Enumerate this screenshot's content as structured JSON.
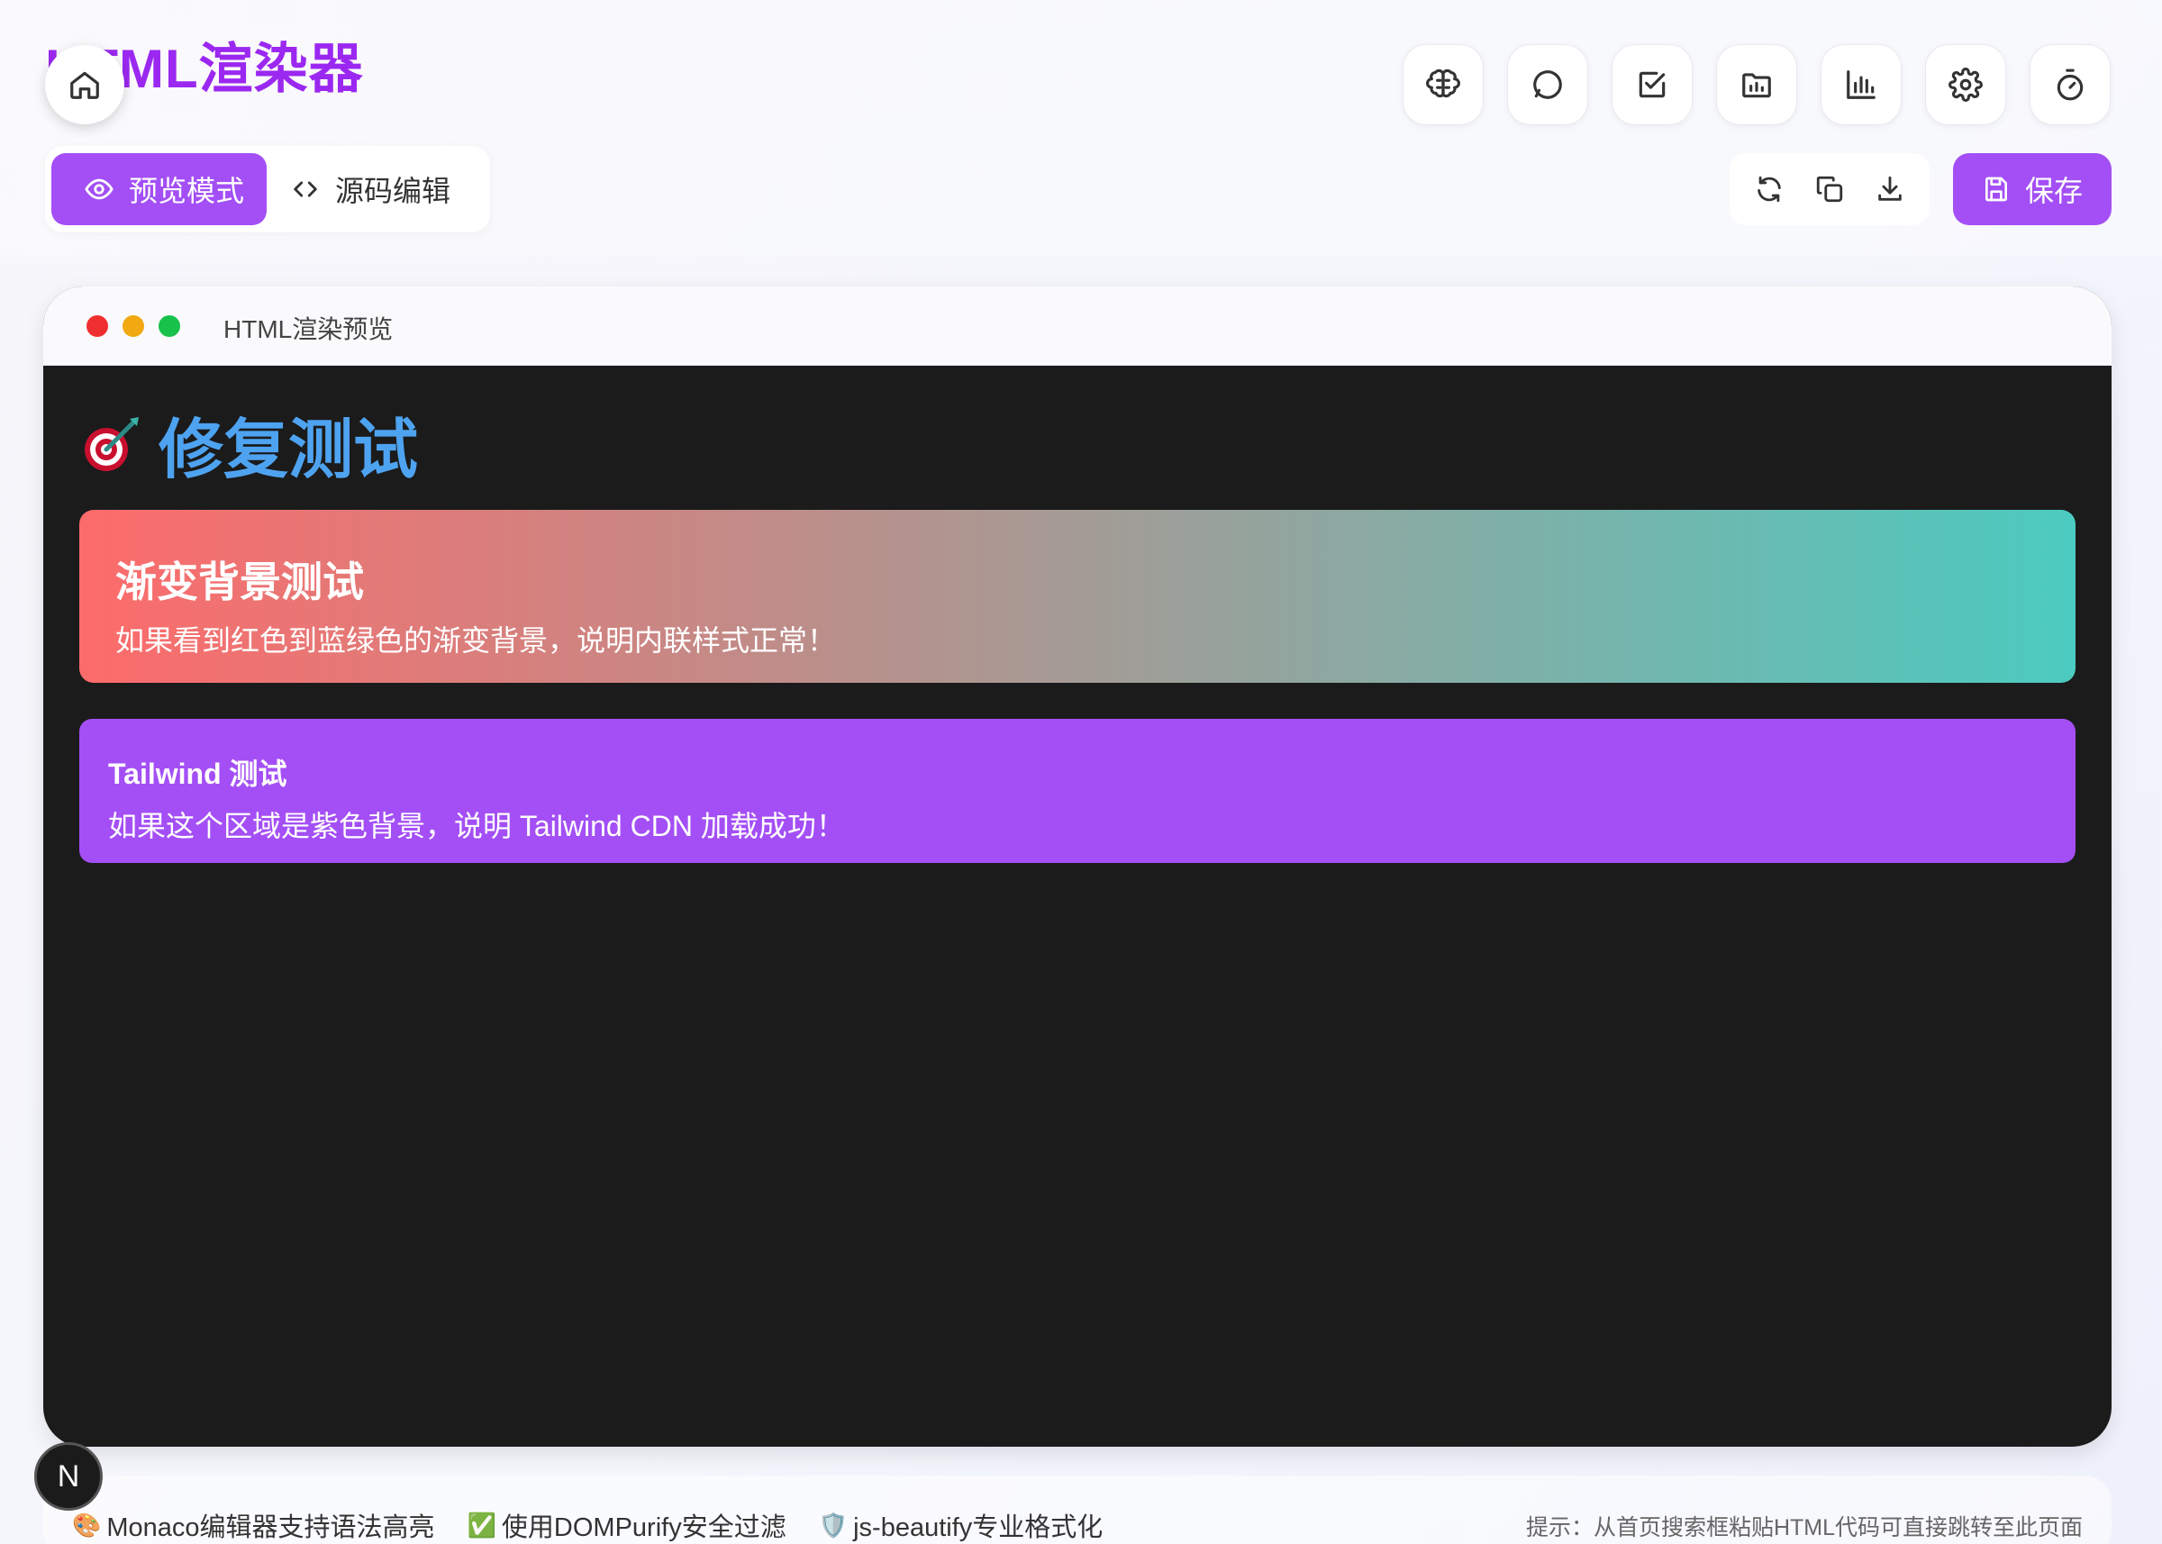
{
  "app": {
    "title": "HTML渲染器"
  },
  "header": {
    "top_icons": [
      "brain-icon",
      "chat-icon",
      "checkbox-icon",
      "folder-chart-icon",
      "bar-chart-icon",
      "gear-icon",
      "timer-icon"
    ]
  },
  "mode_toggle": {
    "preview_label": "预览模式",
    "source_label": "源码编辑"
  },
  "actions": {
    "icons": [
      "refresh-icon",
      "copy-icon",
      "download-icon"
    ],
    "save_label": "保存"
  },
  "preview_window": {
    "title": "HTML渲染预览",
    "page": {
      "heading_emoji": "🎯",
      "heading": "修复测试",
      "gradient_card": {
        "title": "渐变背景测试",
        "description": "如果看到红色到蓝绿色的渐变背景，说明内联样式正常！"
      },
      "tailwind_card": {
        "title": "Tailwind 测试",
        "description": "如果这个区域是紫色背景，说明 Tailwind CDN 加载成功！"
      }
    }
  },
  "footer": {
    "items": [
      {
        "emoji": "🎨",
        "text": "Monaco编辑器支持语法高亮"
      },
      {
        "emoji": "✅",
        "text": "使用DOMPurify安全过滤"
      },
      {
        "emoji": "🛡️",
        "text": "js-beautify专业格式化"
      }
    ],
    "hint": "提示：从首页搜索框粘贴HTML代码可直接跳转至此页面"
  },
  "dev_badge": {
    "letter": "N"
  },
  "colors": {
    "accent": "#a34ff5",
    "title": "#9b28f0",
    "heading": "#4ea3f1",
    "gradient_start": "#fd6b6b",
    "gradient_end": "#4ccbc0"
  }
}
